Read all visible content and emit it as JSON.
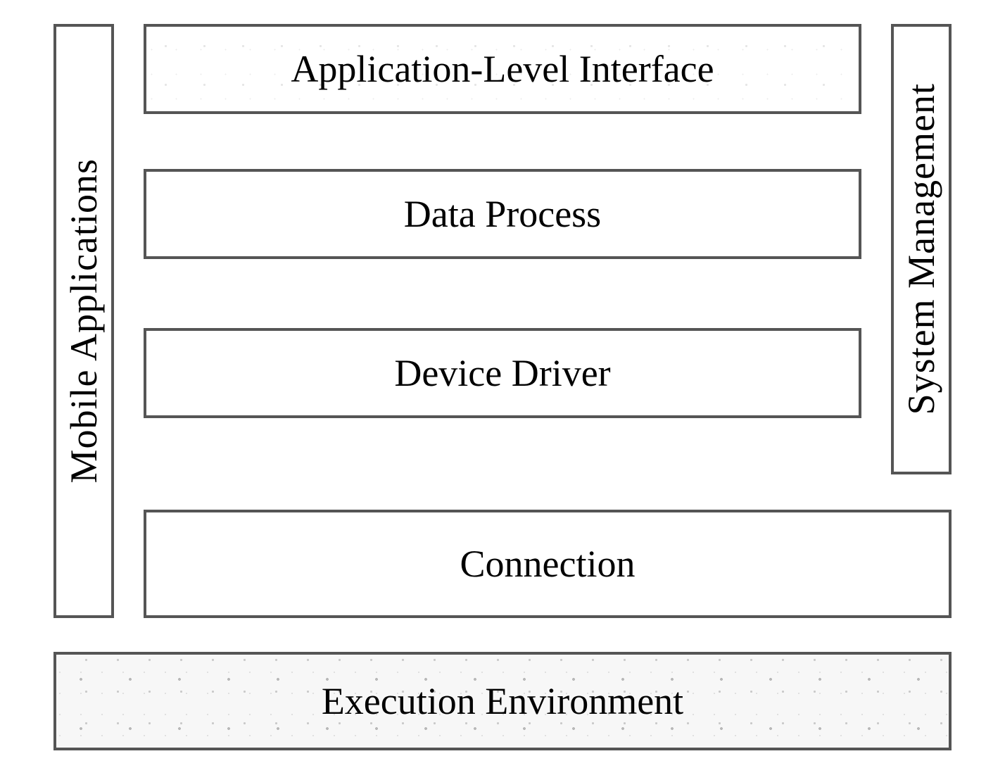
{
  "left_column": {
    "label": "Mobile Applications"
  },
  "right_column": {
    "label": "System Management"
  },
  "middle_layers": {
    "app_interface": "Application-Level Interface",
    "data_process": "Data Process",
    "device_driver": "Device Driver"
  },
  "connection_layer": {
    "label": "Connection"
  },
  "execution_layer": {
    "label": "Execution Environment"
  }
}
